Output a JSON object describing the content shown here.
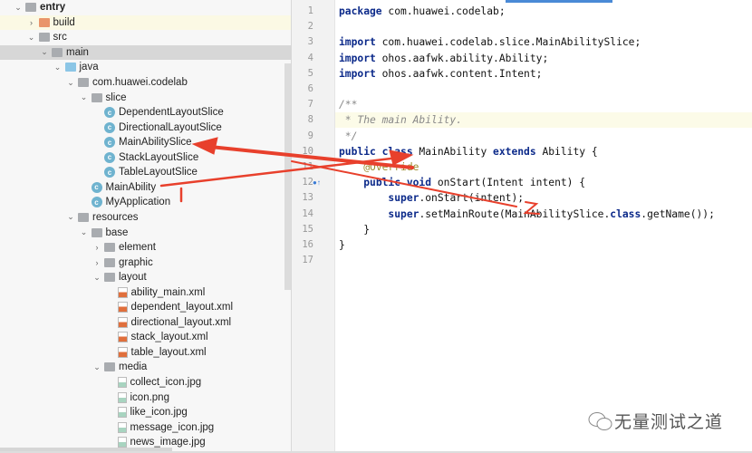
{
  "project_tree": {
    "items": [
      {
        "label": "entry",
        "depth": 0,
        "expand": "open",
        "icon": "module-folder-icon"
      },
      {
        "label": "build",
        "depth": 1,
        "expand": "closed",
        "icon": "folder-orange-icon"
      },
      {
        "label": "src",
        "depth": 1,
        "expand": "open",
        "icon": "folder-icon"
      },
      {
        "label": "main",
        "depth": 2,
        "expand": "open",
        "icon": "folder-icon"
      },
      {
        "label": "java",
        "depth": 3,
        "expand": "open",
        "icon": "source-folder-icon"
      },
      {
        "label": "com.huawei.codelab",
        "depth": 4,
        "expand": "open",
        "icon": "package-icon"
      },
      {
        "label": "slice",
        "depth": 5,
        "expand": "open",
        "icon": "package-icon"
      },
      {
        "label": "DependentLayoutSlice",
        "depth": 6,
        "expand": "",
        "icon": "class-icon"
      },
      {
        "label": "DirectionalLayoutSlice",
        "depth": 6,
        "expand": "",
        "icon": "class-icon"
      },
      {
        "label": "MainAbilitySlice",
        "depth": 6,
        "expand": "",
        "icon": "class-icon"
      },
      {
        "label": "StackLayoutSlice",
        "depth": 6,
        "expand": "",
        "icon": "class-icon"
      },
      {
        "label": "TableLayoutSlice",
        "depth": 6,
        "expand": "",
        "icon": "class-icon"
      },
      {
        "label": "MainAbility",
        "depth": 5,
        "expand": "",
        "icon": "class-icon"
      },
      {
        "label": "MyApplication",
        "depth": 5,
        "expand": "",
        "icon": "class-icon"
      },
      {
        "label": "resources",
        "depth": 4,
        "expand": "open",
        "icon": "resources-folder-icon"
      },
      {
        "label": "base",
        "depth": 5,
        "expand": "open",
        "icon": "folder-icon"
      },
      {
        "label": "element",
        "depth": 6,
        "expand": "closed",
        "icon": "folder-icon"
      },
      {
        "label": "graphic",
        "depth": 6,
        "expand": "closed",
        "icon": "folder-icon"
      },
      {
        "label": "layout",
        "depth": 6,
        "expand": "open",
        "icon": "folder-icon"
      },
      {
        "label": "ability_main.xml",
        "depth": 7,
        "expand": "",
        "icon": "xml-file-icon"
      },
      {
        "label": "dependent_layout.xml",
        "depth": 7,
        "expand": "",
        "icon": "xml-file-icon"
      },
      {
        "label": "directional_layout.xml",
        "depth": 7,
        "expand": "",
        "icon": "xml-file-icon"
      },
      {
        "label": "stack_layout.xml",
        "depth": 7,
        "expand": "",
        "icon": "xml-file-icon"
      },
      {
        "label": "table_layout.xml",
        "depth": 7,
        "expand": "",
        "icon": "xml-file-icon"
      },
      {
        "label": "media",
        "depth": 6,
        "expand": "open",
        "icon": "folder-icon"
      },
      {
        "label": "collect_icon.jpg",
        "depth": 7,
        "expand": "",
        "icon": "image-file-icon"
      },
      {
        "label": "icon.png",
        "depth": 7,
        "expand": "",
        "icon": "image-file-icon"
      },
      {
        "label": "like_icon.jpg",
        "depth": 7,
        "expand": "",
        "icon": "image-file-icon"
      },
      {
        "label": "message_icon.jpg",
        "depth": 7,
        "expand": "",
        "icon": "image-file-icon"
      },
      {
        "label": "news_image.jpg",
        "depth": 7,
        "expand": "",
        "icon": "image-file-icon"
      }
    ],
    "selected": "main"
  },
  "editor": {
    "current_line": 8,
    "lines": [
      [
        {
          "t": "package",
          "c": "kw"
        },
        {
          "t": " com.huawei.codelab;"
        }
      ],
      [],
      [
        {
          "t": "import",
          "c": "kw"
        },
        {
          "t": " com.huawei.codelab.slice.MainAbilitySlice;"
        }
      ],
      [
        {
          "t": "import",
          "c": "kw"
        },
        {
          "t": " ohos.aafwk.ability.Ability;"
        }
      ],
      [
        {
          "t": "import",
          "c": "kw"
        },
        {
          "t": " ohos.aafwk.content.Intent;"
        }
      ],
      [],
      [
        {
          "t": "/**",
          "c": "cm"
        }
      ],
      [
        {
          "t": " * The main Ability.",
          "c": "cm"
        }
      ],
      [
        {
          "t": " */",
          "c": "cm"
        }
      ],
      [
        {
          "t": "public class",
          "c": "kw"
        },
        {
          "t": " MainAbility "
        },
        {
          "t": "extends",
          "c": "kw"
        },
        {
          "t": " Ability {"
        }
      ],
      [
        {
          "t": "    "
        },
        {
          "t": "@Override",
          "c": "an"
        }
      ],
      [
        {
          "t": "    "
        },
        {
          "t": "public void",
          "c": "kw"
        },
        {
          "t": " onStart(Intent intent) {"
        }
      ],
      [
        {
          "t": "        "
        },
        {
          "t": "super",
          "c": "kw"
        },
        {
          "t": ".onStart(intent);"
        }
      ],
      [
        {
          "t": "        "
        },
        {
          "t": "super",
          "c": "kw"
        },
        {
          "t": ".setMainRoute(MainAbilitySlice."
        },
        {
          "t": "class",
          "c": "kw"
        },
        {
          "t": ".getName());"
        }
      ],
      [
        {
          "t": "    }"
        }
      ],
      [
        {
          "t": "}"
        }
      ],
      []
    ]
  },
  "watermark": {
    "text": "无量测试之道",
    "icon": "wechat-icon"
  },
  "colors": {
    "annotation_red": "#e8402c",
    "keyword": "#0c2a8a"
  }
}
